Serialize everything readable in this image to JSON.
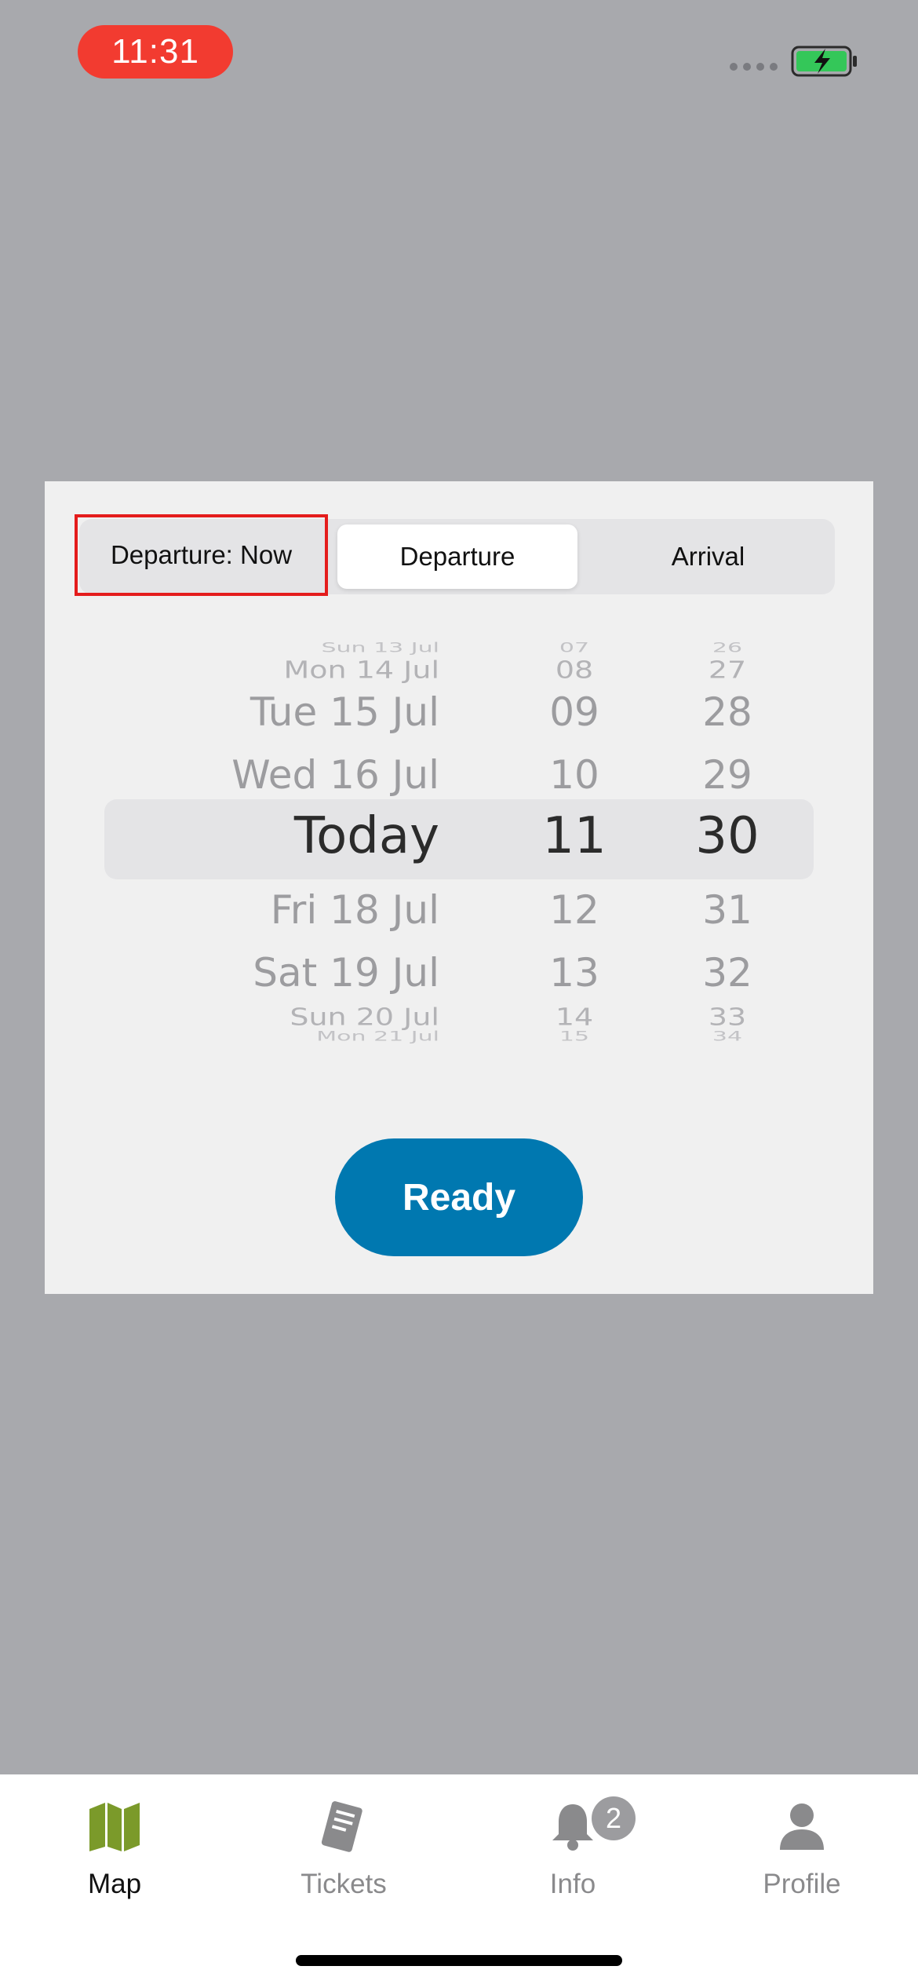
{
  "status_bar": {
    "time": "11:31"
  },
  "segmented": {
    "departure_now": "Departure: Now",
    "departure": "Departure",
    "arrival": "Arrival"
  },
  "picker": {
    "days": [
      "Sun 13 Jul",
      "Mon 14 Jul",
      "Tue 15 Jul",
      "Wed 16 Jul",
      "Today",
      "Fri 18 Jul",
      "Sat 19 Jul",
      "Sun 20 Jul",
      "Mon 21 Jul"
    ],
    "hours": [
      "07",
      "08",
      "09",
      "10",
      "11",
      "12",
      "13",
      "14",
      "15"
    ],
    "minutes": [
      "26",
      "27",
      "28",
      "29",
      "30",
      "31",
      "32",
      "33",
      "34"
    ],
    "selected": {
      "day": "Today",
      "hour": "11",
      "minute": "30"
    }
  },
  "ready_label": "Ready",
  "tabs": {
    "map": "Map",
    "tickets": "Tickets",
    "info": "Info",
    "info_badge": "2",
    "profile": "Profile"
  },
  "colors": {
    "accent": "#0078b0",
    "map_icon": "#7b9a2a",
    "time_pill": "#f23b30",
    "battery": "#34c759"
  }
}
